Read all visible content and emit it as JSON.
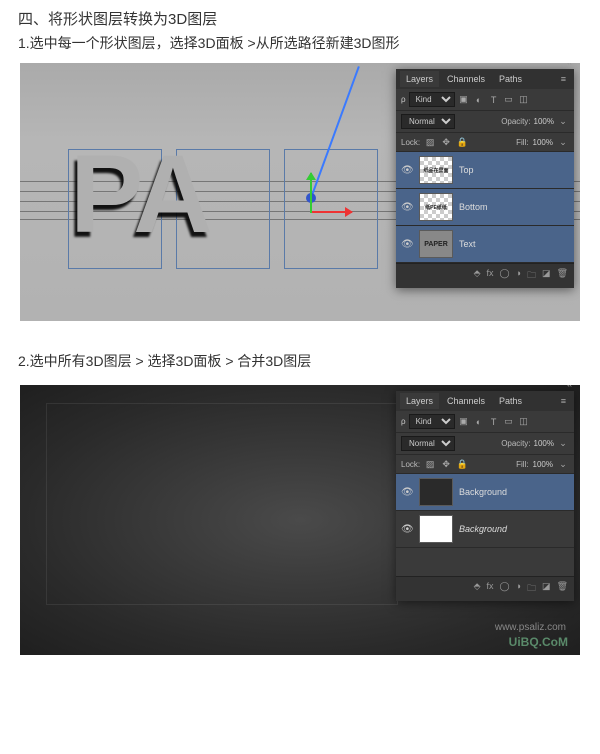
{
  "doc": {
    "section_title_num": "四、",
    "section_title": "将形状图层转换为3D图层",
    "step1": "1.选中每一个形状图层，选择3D面板 >从所选路径新建3D图形",
    "step2": "2.选中所有3D图层 > 选择3D面板 > 合并3D图层",
    "watermark_url": "www.psaliz.com",
    "brand": "UiBQ.CoM"
  },
  "panel": {
    "tabs": {
      "layers": "Layers",
      "channels": "Channels",
      "paths": "Paths"
    },
    "filter_label": "Kind",
    "blend_mode": "Normal",
    "opacity_label": "Opacity:",
    "opacity_value": "100%",
    "fill_label": "Fill:",
    "fill_value": "100%",
    "lock_label": "Lock:"
  },
  "layers1": [
    {
      "name": "Top",
      "thumb_text": "纸品在里面"
    },
    {
      "name": "Bottom",
      "thumb_text": "纸PE纸纸"
    },
    {
      "name": "Text",
      "thumb_text": "PAPER"
    }
  ],
  "layers2": [
    {
      "name": "Background"
    },
    {
      "name": "Background"
    }
  ],
  "icons": {
    "menu": "≡",
    "close": "«",
    "eye": "👁",
    "link": "⬚",
    "fx": "fx",
    "mask": "◯",
    "folder": "🗀",
    "new": "◪",
    "trash": "🗑",
    "dropdown": "⌄",
    "image": "▣",
    "adjust": "◐",
    "text": "T",
    "shape": "▭",
    "smart": "◫"
  },
  "canvas1": {
    "letters": "PA"
  }
}
